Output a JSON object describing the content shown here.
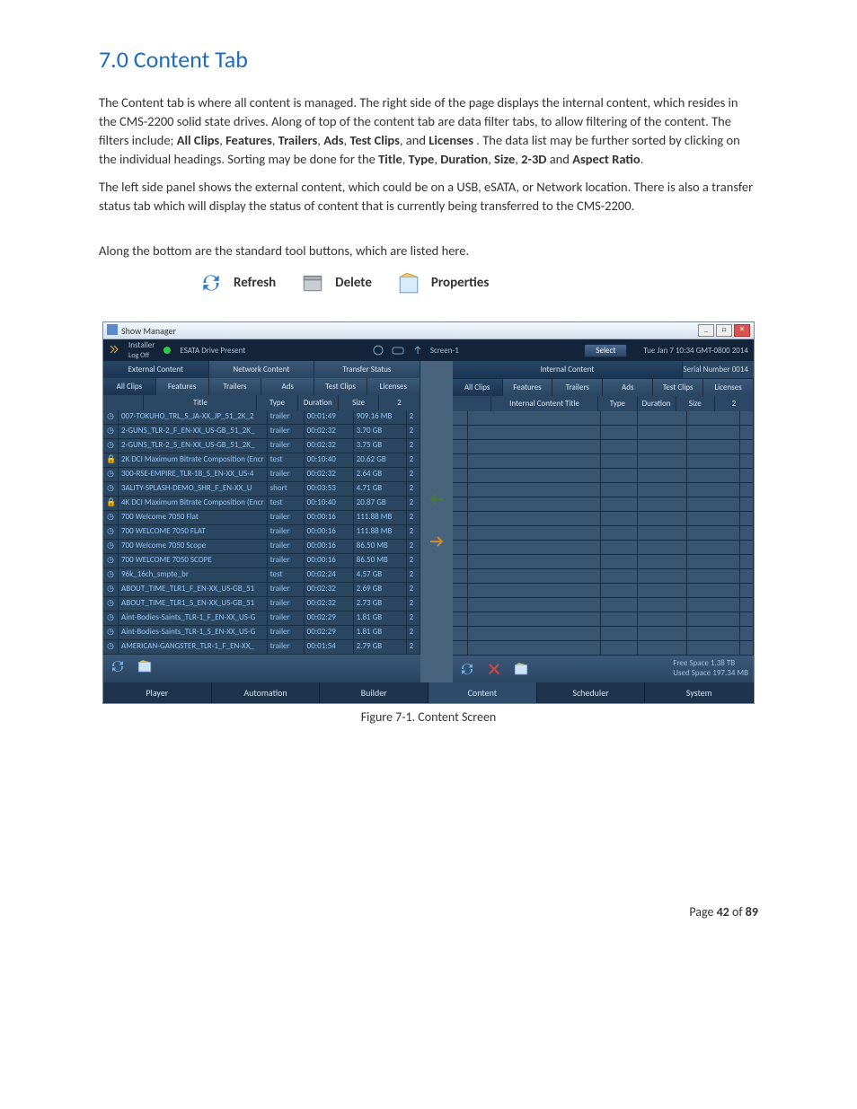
{
  "doc": {
    "heading": "7.0 Content Tab",
    "para1_a": "The Content tab is where all content is managed.  The right side of the page displays the internal content, which resides in the CMS-2200 solid state drives.  Along of top of the content tab are data filter tabs, to allow filtering of the content.  The filters include; ",
    "para1_b": ".  The data list may be further sorted by clicking on the individual headings.  Sorting may be done for the ",
    "filters": [
      "All Clips",
      "Features",
      "Trailers",
      "Ads",
      "Test Clips"
    ],
    "licenses_word": "Licenses",
    "and_word": " and ",
    "sort_cols": [
      "Title",
      "Type",
      "Duration",
      "Size",
      "2-3D",
      "Aspect Ratio"
    ],
    "para2": "The left side panel shows the external content, which could be on a USB, eSATA, or Network location.  There is also a transfer status tab which will display the status of content that is currently being transferred to the CMS-2200.",
    "para3": "Along the bottom are the standard tool buttons, which are listed here.",
    "tool_refresh": "Refresh",
    "tool_delete": "Delete",
    "tool_properties": "Properties",
    "figure_caption": "Figure 7-1.  Content Screen",
    "page_label_a": "Page ",
    "page_current": "42",
    "page_label_b": " of ",
    "page_total": "89"
  },
  "app": {
    "window_title": "Show Manager",
    "installer": "Installer",
    "logoff": "Log Off",
    "esata": "ESATA Drive Present",
    "screen": "Screen-1",
    "select_btn": "Select",
    "datetime": "Tue Jan 7 10:34 GMT-0800 2014",
    "left_tabs": [
      "External Content",
      "Network Content",
      "Transfer Status"
    ],
    "subtabs": [
      "All Clips",
      "Features",
      "Trailers",
      "Ads",
      "Test Clips",
      "Licenses"
    ],
    "cols_left": [
      "Title",
      "Type",
      "Duration",
      "Size",
      "2"
    ],
    "right_header": "Internal Content",
    "serial": "Serial Number 0014",
    "cols_right": [
      "Internal Content Title",
      "Type",
      "Duration",
      "Size",
      "2"
    ],
    "free_space": "Free Space 1.38 TB",
    "used_space": "Used Space 197.34 MB",
    "navtabs": [
      "Player",
      "Automation",
      "Builder",
      "Content",
      "Scheduler",
      "System"
    ],
    "rows": [
      {
        "lock": false,
        "title": "007-TOKUHO_TRL_S_JA-XX_JP_51_2K_2",
        "type": "trailer",
        "dur": "00:01:49",
        "size": "909.16 MB",
        "ar": "2"
      },
      {
        "lock": false,
        "title": "2-GUNS_TLR-2_F_EN-XX_US-GB_51_2K_",
        "type": "trailer",
        "dur": "00:02:32",
        "size": "3.70 GB",
        "ar": "2"
      },
      {
        "lock": false,
        "title": "2-GUNS_TLR-2_S_EN-XX_US-GB_51_2K_",
        "type": "trailer",
        "dur": "00:02:32",
        "size": "3.75 GB",
        "ar": "2"
      },
      {
        "lock": true,
        "title": "2K DCI Maximum Bitrate Composition (Encr",
        "type": "test",
        "dur": "00:10:40",
        "size": "20.62 GB",
        "ar": "2"
      },
      {
        "lock": false,
        "title": "300-RSE-EMPIRE_TLR-1B_S_EN-XX_US-4",
        "type": "trailer",
        "dur": "00:02:32",
        "size": "2.64 GB",
        "ar": "2"
      },
      {
        "lock": false,
        "title": "3ALITY-SPLASH-DEMO_SHR_F_EN-XX_U",
        "type": "short",
        "dur": "00:03:53",
        "size": "4.71 GB",
        "ar": "2"
      },
      {
        "lock": true,
        "title": "4K DCI Maximum Bitrate Composition (Encr",
        "type": "test",
        "dur": "00:10:40",
        "size": "20.87 GB",
        "ar": "2"
      },
      {
        "lock": false,
        "title": "700 Welcome 7050 Flat",
        "type": "trailer",
        "dur": "00:00:16",
        "size": "111.88 MB",
        "ar": "2"
      },
      {
        "lock": false,
        "title": "700 WELCOME 7050 FLAT",
        "type": "trailer",
        "dur": "00:00:16",
        "size": "111.88 MB",
        "ar": "2"
      },
      {
        "lock": false,
        "title": "700 Welcome 7050 Scope",
        "type": "trailer",
        "dur": "00:00:16",
        "size": "86.50 MB",
        "ar": "2"
      },
      {
        "lock": false,
        "title": "700 WELCOME 7050 SCOPE",
        "type": "trailer",
        "dur": "00:00:16",
        "size": "86.50 MB",
        "ar": "2"
      },
      {
        "lock": false,
        "title": "96k_16ch_smpte_br",
        "type": "test",
        "dur": "00:02:24",
        "size": "4.57 GB",
        "ar": "2"
      },
      {
        "lock": false,
        "title": "ABOUT_TIME_TLR1_F_EN-XX_US-GB_51",
        "type": "trailer",
        "dur": "00:02:32",
        "size": "2.69 GB",
        "ar": "2"
      },
      {
        "lock": false,
        "title": "ABOUT_TIME_TLR1_S_EN-XX_US-GB_51",
        "type": "trailer",
        "dur": "00:02:32",
        "size": "2.73 GB",
        "ar": "2"
      },
      {
        "lock": false,
        "title": "Aint-Bodies-Saints_TLR-1_F_EN-XX_US-G",
        "type": "trailer",
        "dur": "00:02:29",
        "size": "1.81 GB",
        "ar": "2"
      },
      {
        "lock": false,
        "title": "Aint-Bodies-Saints_TLR-1_S_EN-XX_US-G",
        "type": "trailer",
        "dur": "00:02:29",
        "size": "1.81 GB",
        "ar": "2"
      },
      {
        "lock": false,
        "title": "AMERICAN-GANGSTER_TLR-1_F_EN-XX_",
        "type": "trailer",
        "dur": "00:01:54",
        "size": "2.79 GB",
        "ar": "2"
      }
    ]
  }
}
